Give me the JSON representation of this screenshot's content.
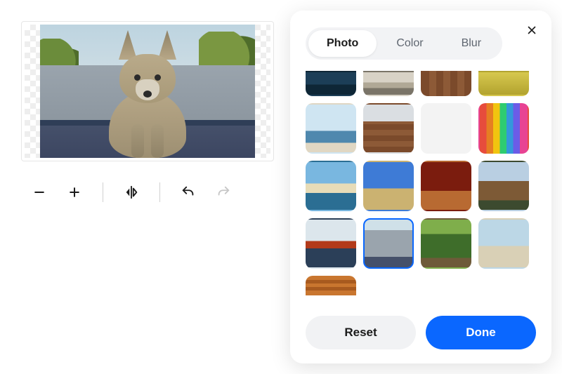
{
  "preview": {
    "subject": "coyote",
    "background_selected": "bg-wallgrey"
  },
  "toolbar": {
    "zoom_out": "−",
    "zoom_in": "+",
    "flip": "flip-horizontal",
    "undo": "undo",
    "redo": "redo",
    "redo_enabled": false
  },
  "picker": {
    "tabs": {
      "photo": "Photo",
      "color": "Color",
      "blur": "Blur",
      "active": "photo"
    },
    "thumbs": [
      {
        "id": "bg-ocean",
        "row": "top"
      },
      {
        "id": "bg-street",
        "row": "top"
      },
      {
        "id": "bg-boards",
        "row": "top"
      },
      {
        "id": "bg-field",
        "row": "top"
      },
      {
        "id": "bg-harbor"
      },
      {
        "id": "bg-floor"
      },
      {
        "id": "bg-gradient"
      },
      {
        "id": "bg-stripes"
      },
      {
        "id": "bg-coast"
      },
      {
        "id": "bg-plain"
      },
      {
        "id": "bg-autumn"
      },
      {
        "id": "bg-cabin"
      },
      {
        "id": "bg-bridge"
      },
      {
        "id": "bg-wallgrey",
        "selected": true
      },
      {
        "id": "bg-jungle"
      },
      {
        "id": "bg-palms"
      },
      {
        "id": "bg-slats",
        "row": "bot"
      }
    ],
    "reset": "Reset",
    "done": "Done"
  }
}
